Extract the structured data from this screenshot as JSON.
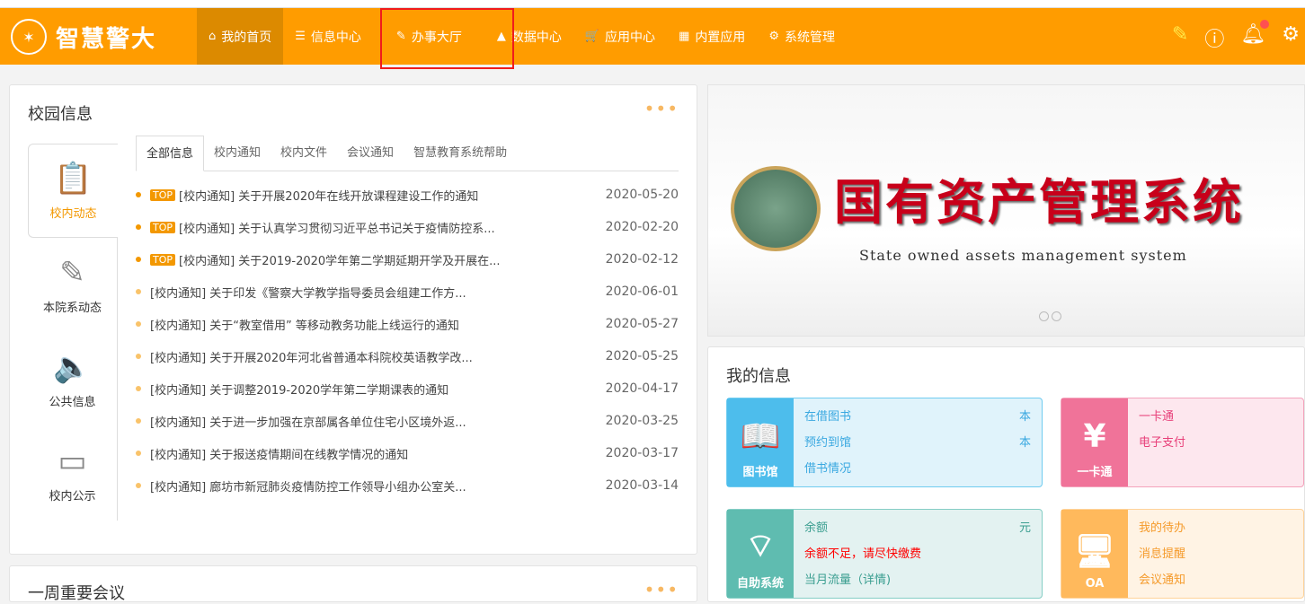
{
  "header": {
    "logo_text": "智慧警大",
    "nav": [
      {
        "label": "我的首页",
        "icon": "home-icon",
        "glyph": "⌂"
      },
      {
        "label": "信息中心",
        "icon": "list-icon",
        "glyph": "☰"
      },
      {
        "label": "办事大厅",
        "icon": "edit-icon",
        "glyph": "✎"
      },
      {
        "label": "数据中心",
        "icon": "chart-icon",
        "glyph": "▲"
      },
      {
        "label": "应用中心",
        "icon": "cart-icon",
        "glyph": "🛒"
      },
      {
        "label": "内置应用",
        "icon": "grid-icon",
        "glyph": "▦"
      },
      {
        "label": "系统管理",
        "icon": "gear-icon",
        "glyph": "⚙"
      }
    ]
  },
  "campus": {
    "title": "校园信息",
    "more": "•••",
    "side_tabs": [
      {
        "label": "校内动态",
        "glyph": "📋"
      },
      {
        "label": "本院系动态",
        "glyph": "✎"
      },
      {
        "label": "公共信息",
        "glyph": "🔈"
      },
      {
        "label": "校内公示",
        "glyph": "▭"
      }
    ],
    "tabs": [
      "全部信息",
      "校内通知",
      "校内文件",
      "会议通知",
      "智慧教育系统帮助"
    ],
    "top_badge": "TOP",
    "news": [
      {
        "top": true,
        "title": "[校内通知] 关于开展2020年在线开放课程建设工作的通知",
        "date": "2020-05-20"
      },
      {
        "top": true,
        "title": "[校内通知] 关于认真学习贯彻习近平总书记关于疫情防控系...",
        "date": "2020-02-20"
      },
      {
        "top": true,
        "title": "[校内通知] 关于2019-2020学年第二学期延期开学及开展在...",
        "date": "2020-02-12"
      },
      {
        "top": false,
        "title": "[校内通知] 关于印发《警察大学教学指导委员会组建工作方...",
        "date": "2020-06-01"
      },
      {
        "top": false,
        "title": "[校内通知] 关于“教室借用” 等移动教务功能上线运行的通知",
        "date": "2020-05-27"
      },
      {
        "top": false,
        "title": "[校内通知] 关于开展2020年河北省普通本科院校英语教学改...",
        "date": "2020-05-25"
      },
      {
        "top": false,
        "title": "[校内通知] 关于调整2019-2020学年第二学期课表的通知",
        "date": "2020-04-17"
      },
      {
        "top": false,
        "title": "[校内通知] 关于进一步加强在京部属各单位住宅小区境外返...",
        "date": "2020-03-25"
      },
      {
        "top": false,
        "title": "[校内通知] 关于报送疫情期间在线教学情况的通知",
        "date": "2020-03-17"
      },
      {
        "top": false,
        "title": "[校内通知] 廊坊市新冠肺炎疫情防控工作领导小组办公室关...",
        "date": "2020-03-14"
      }
    ]
  },
  "meeting": {
    "title": "一周重要会议",
    "more": "•••"
  },
  "banner": {
    "title": "国有资产管理系统",
    "subtitle": "State owned assets management system"
  },
  "myinfo": {
    "title": "我的信息",
    "cards": [
      {
        "name": "图书馆",
        "glyph": "📖",
        "lines": [
          {
            "t": "在借图书",
            "u": "本"
          },
          {
            "t": "预约到馆",
            "u": "本"
          },
          {
            "t": "借书情况",
            "u": ""
          }
        ]
      },
      {
        "name": "一卡通",
        "glyph": "¥",
        "lines": [
          {
            "t": "一卡通",
            "u": ""
          },
          {
            "t": "电子支付",
            "u": ""
          }
        ]
      },
      {
        "name": "自助系统",
        "glyph": "⌔",
        "lines": [
          {
            "t": "余额",
            "u": "元"
          },
          {
            "t": "余额不足，请尽快缴费",
            "u": ""
          },
          {
            "t": "当月流量（详情)",
            "u": ""
          }
        ]
      },
      {
        "name": "OA",
        "glyph": "🖥",
        "lines": [
          {
            "t": "我的待办",
            "u": ""
          },
          {
            "t": "消息提醒",
            "u": ""
          },
          {
            "t": "会议通知",
            "u": ""
          }
        ]
      }
    ]
  }
}
